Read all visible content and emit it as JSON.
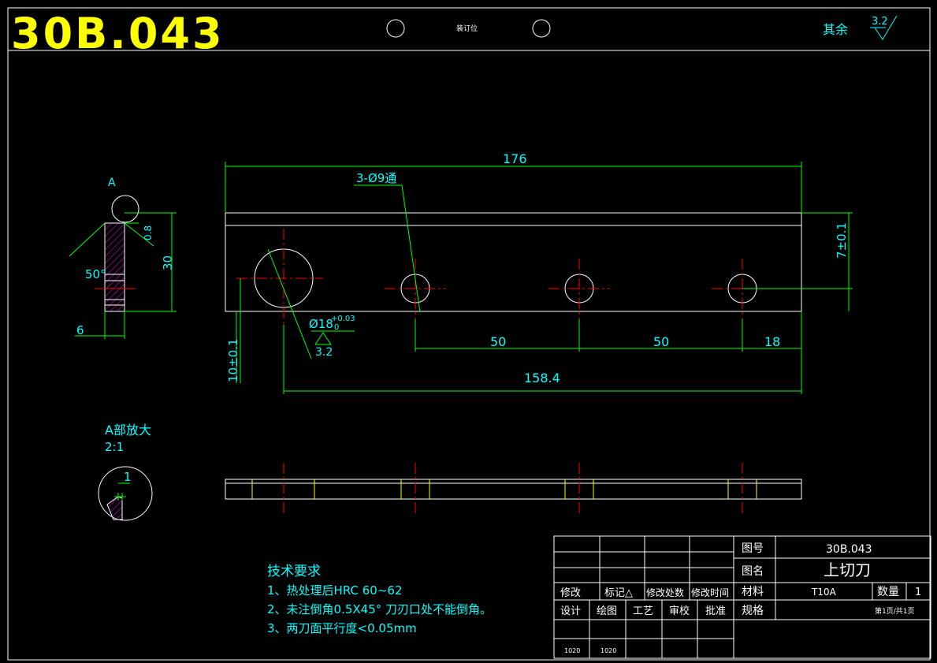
{
  "header": {
    "drawing_code": "30B.043",
    "binding_label": "装订位",
    "remaining_roughness_label": "其余",
    "remaining_roughness_value": "3.2"
  },
  "detail_views": {
    "section_label": "A",
    "angle": "50°",
    "chamfer": "0.8",
    "height": "30",
    "thickness": "6",
    "enlarge_title": "A部放大",
    "enlarge_scale": "2:1",
    "enlarge_dim": "1"
  },
  "main_view": {
    "overall_length": "176",
    "hole_callout": "3-Ø9通",
    "big_hole_dia": "Ø18",
    "big_hole_tol_upper": "+0.03",
    "big_hole_tol_lower": "0",
    "big_hole_roughness": "3.2",
    "vertical_right": "7±0.1",
    "vertical_left": "10±0.1",
    "spacing_1": "50",
    "spacing_2": "50",
    "end_distance": "18",
    "hole_span": "158.4"
  },
  "tech_requirements": {
    "title": "技术要求",
    "items": [
      "1、热处理后HRC 60~62",
      "2、未注倒角0.5X45° 刀刃口处不能倒角。",
      "3、两刀面平行度<0.05mm"
    ]
  },
  "title_block": {
    "drawing_no_label": "图号",
    "drawing_no_value": "30B.043",
    "name_label": "图名",
    "name_value": "上切刀",
    "material_label": "材料",
    "material_value": "T10A",
    "qty_label": "数量",
    "qty_value": "1",
    "spec_label": "规格",
    "page_info": "第1页/共1页",
    "revision_headers": [
      "修改",
      "标记△",
      "修改处数",
      "修改时间"
    ],
    "sign_headers": [
      "设计",
      "绘图",
      "工艺",
      "审校",
      "批准"
    ],
    "sign_values": [
      "1020",
      "1020"
    ]
  }
}
